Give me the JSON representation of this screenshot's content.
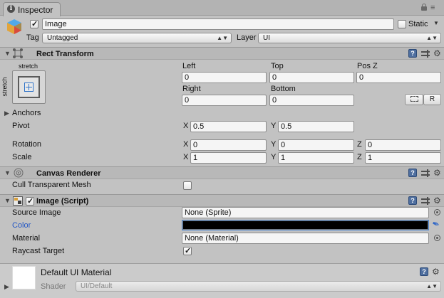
{
  "window": {
    "tab_title": "Inspector"
  },
  "object": {
    "name": "Image",
    "active": true,
    "static_label": "Static",
    "static_checked": false,
    "tag_label": "Tag",
    "tag_value": "Untagged",
    "layer_label": "Layer",
    "layer_value": "UI"
  },
  "rect_transform": {
    "title": "Rect Transform",
    "stretch_top": "stretch",
    "stretch_side": "stretch",
    "left_label": "Left",
    "left_value": "0",
    "top_label": "Top",
    "top_value": "0",
    "posz_label": "Pos Z",
    "posz_value": "0",
    "right_label": "Right",
    "right_value": "0",
    "bottom_label": "Bottom",
    "bottom_value": "0",
    "r_button": "R",
    "anchors_label": "Anchors",
    "pivot_label": "Pivot",
    "pivot": {
      "x_label": "X",
      "x": "0.5",
      "y_label": "Y",
      "y": "0.5"
    },
    "rotation_label": "Rotation",
    "rotation": {
      "x_label": "X",
      "x": "0",
      "y_label": "Y",
      "y": "0",
      "z_label": "Z",
      "z": "0"
    },
    "scale_label": "Scale",
    "scale": {
      "x_label": "X",
      "x": "1",
      "y_label": "Y",
      "y": "1",
      "z_label": "Z",
      "z": "1"
    }
  },
  "canvas_renderer": {
    "title": "Canvas Renderer",
    "cull_label": "Cull Transparent Mesh",
    "cull_checked": false
  },
  "image_script": {
    "title": "Image (Script)",
    "enabled": true,
    "source_image_label": "Source Image",
    "source_image_value": "None (Sprite)",
    "color_label": "Color",
    "color_value": "#000000",
    "material_label": "Material",
    "material_value": "None (Material)",
    "raycast_label": "Raycast Target",
    "raycast_checked": true
  },
  "material": {
    "name": "Default UI Material",
    "shader_label": "Shader",
    "shader_value": "UI/Default"
  },
  "colors": {
    "panel": "#c2c2c2",
    "header": "#b8b8b8",
    "accent_blue": "#2f66c7"
  },
  "icons": [
    "info-icon",
    "lock-icon",
    "menu-icon",
    "gameobject-cube-icon",
    "rect-transform-icon",
    "canvas-renderer-icon",
    "image-script-icon",
    "help-icon",
    "preset-icon",
    "gear-icon",
    "eyedropper-icon",
    "object-picker-icon"
  ]
}
